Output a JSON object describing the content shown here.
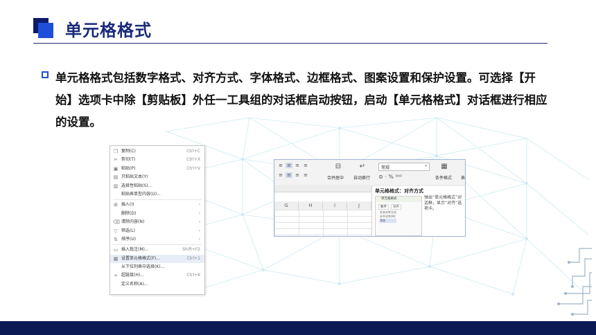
{
  "slide": {
    "title": "单元格格式",
    "body": "单元格格式包括数字格式、对齐方式、字体格式、边框格式、图案设置和保护设置。可选择【开始】选项卡中除【剪贴板】外任一工具组的对话框启动按钮，启动【单元格格式】对话框进行相应的设置。"
  },
  "context_menu": {
    "items": [
      {
        "label": "复制(C)",
        "shortcut": "Ctrl+C",
        "icon": "copy-icon"
      },
      {
        "label": "剪切(T)",
        "shortcut": "Ctrl+X",
        "icon": "scissors-icon"
      },
      {
        "label": "粘贴(P)",
        "shortcut": "Ctrl+V",
        "icon": "paste-icon"
      },
      {
        "label": "只粘贴文本(Y)",
        "shortcut": "",
        "icon": "paste-text-icon"
      },
      {
        "label": "选择性粘贴(S)...",
        "shortcut": "",
        "icon": "paste-special-icon"
      },
      {
        "label": "粘贴表单型内容(U)...",
        "shortcut": "",
        "icon": ""
      },
      {
        "label": "插入(I)",
        "shortcut": "›",
        "icon": "insert-icon"
      },
      {
        "label": "删除(D)",
        "shortcut": "›",
        "icon": ""
      },
      {
        "label": "清除内容(N)",
        "shortcut": "›",
        "icon": "eraser-icon"
      },
      {
        "label": "筛选(L)",
        "shortcut": "›",
        "icon": "filter-icon"
      },
      {
        "label": "排序(U)",
        "shortcut": "›",
        "icon": "sort-icon"
      },
      {
        "label": "插入批注(M)...",
        "shortcut": "Shift+F2",
        "icon": "comment-icon"
      },
      {
        "label": "设置单元格格式(F)...",
        "shortcut": "Ctrl+1",
        "icon": "format-cells-icon"
      },
      {
        "label": "从下拉列表中选择(K)...",
        "shortcut": "",
        "icon": ""
      },
      {
        "label": "超链接(H)...",
        "shortcut": "Ctrl+K",
        "icon": "link-icon"
      },
      {
        "label": "定义名称(A)...",
        "shortcut": "",
        "icon": ""
      }
    ]
  },
  "ribbon": {
    "merge_label": "合并居中",
    "wrap_label": "自动换行",
    "number_format": "常规",
    "conditional_label": "条件格式",
    "more_label": "表",
    "columns": [
      "G",
      "H",
      "I",
      "J"
    ]
  },
  "tooltip": {
    "title": "单元格格式：对齐方式",
    "description": "弹出“单元格格式”对话框，显示“对齐”选项卡。",
    "thumb_header": "单元格格式",
    "thumb_tabs": [
      "数字",
      "对齐"
    ],
    "thumb_line1": "文本对齐方式",
    "thumb_line2": "水平对齐(H):",
    "thumb_line3": "常规"
  }
}
